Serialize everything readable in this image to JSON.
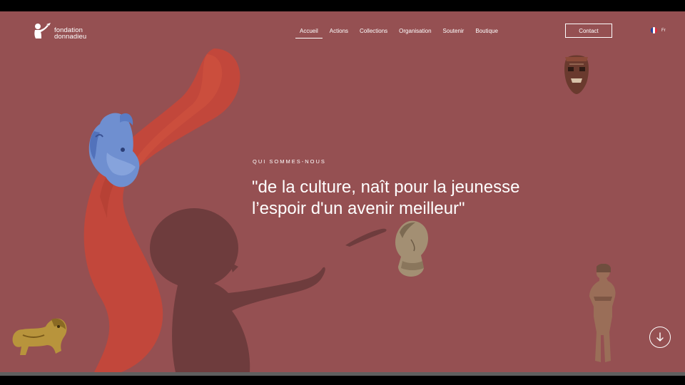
{
  "logo": {
    "line1": "fondation",
    "line2": "donnadieu"
  },
  "nav": {
    "items": [
      {
        "label": "Accueil",
        "active": true
      },
      {
        "label": "Actions"
      },
      {
        "label": "Collections"
      },
      {
        "label": "Organisation"
      },
      {
        "label": "Soutenir"
      },
      {
        "label": "Boutique"
      }
    ]
  },
  "contact": {
    "label": "Contact"
  },
  "language": {
    "label": "Fr",
    "flag": "france-flag-icon"
  },
  "hero": {
    "kicker": "QUI SOMMES-NOUS",
    "headline": "\"de la culture, naît pour la jeunesse l’espoir d'un avenir meilleur\""
  },
  "colors": {
    "background": "#955052",
    "brush": "#c4473a",
    "silhouette": "#6e3c3d",
    "text": "#ffffff"
  },
  "icons": {
    "scroll": "arrow-down-circle-icon"
  }
}
